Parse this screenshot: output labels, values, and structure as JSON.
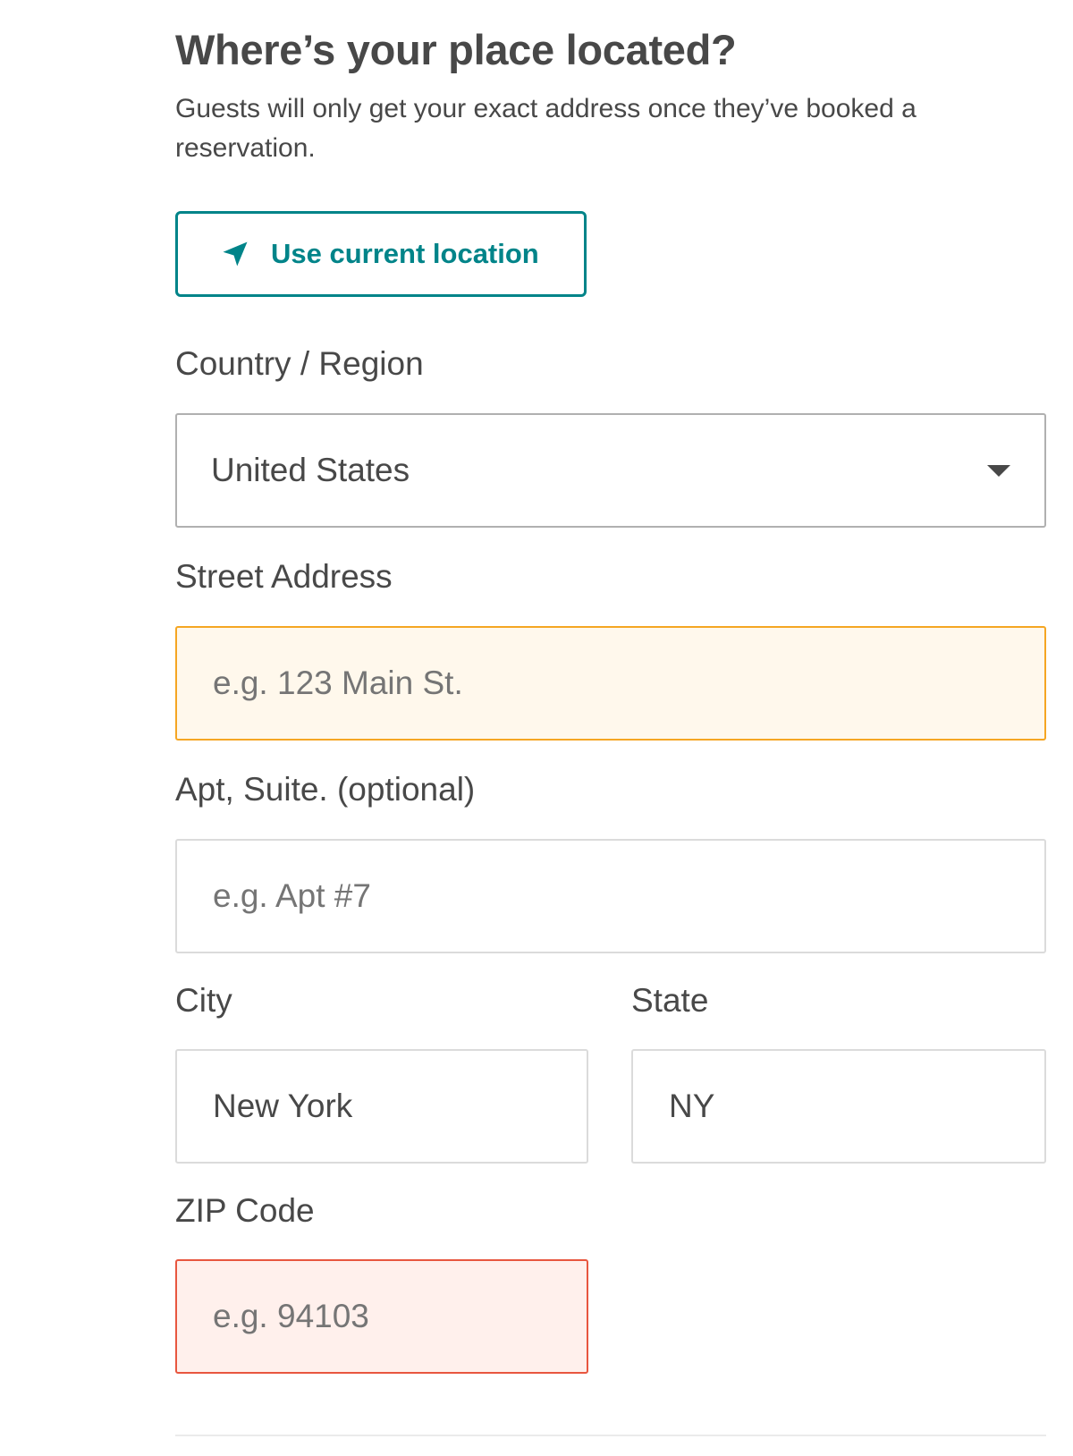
{
  "header": {
    "title": "Where’s your place located?",
    "subtitle": "Guests will only get your exact address once they’ve booked a reservation."
  },
  "location_button": {
    "icon": "navigation-arrow-icon",
    "label": "Use current location",
    "color": "#008489"
  },
  "form": {
    "country": {
      "label": "Country / Region",
      "value": "United States",
      "icon": "chevron-down-icon"
    },
    "street": {
      "label": "Street Address",
      "placeholder": "e.g. 123 Main St.",
      "state": "warning",
      "border_color": "#f5a623"
    },
    "apt": {
      "label": "Apt, Suite. (optional)",
      "placeholder": "e.g. Apt #7"
    },
    "city": {
      "label": "City",
      "value": "New York"
    },
    "state": {
      "label": "State",
      "value": "NY"
    },
    "zip": {
      "label": "ZIP Code",
      "placeholder": "e.g. 94103",
      "state": "error",
      "border_color": "#e8563f"
    }
  }
}
